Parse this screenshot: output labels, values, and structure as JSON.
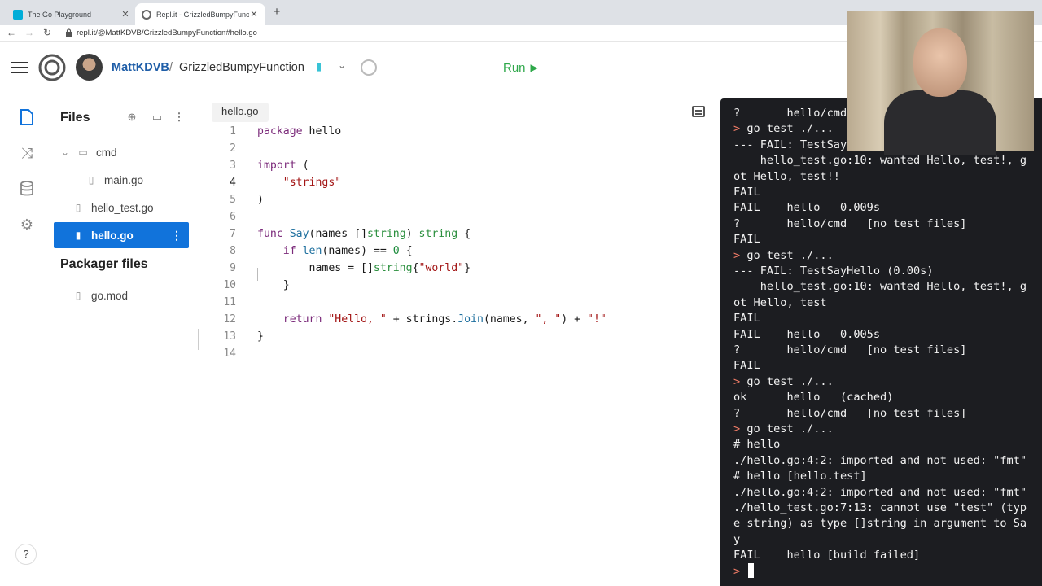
{
  "browser": {
    "tabs": [
      {
        "title": "The Go Playground",
        "active": false
      },
      {
        "title": "Repl.it - GrizzledBumpyFuncti",
        "active": true
      }
    ],
    "url": "repl.it/@MattKDVB/GrizzledBumpyFunction#hello.go"
  },
  "header": {
    "user": "MattKDVB",
    "separator": "/",
    "project": "GrizzledBumpyFunction",
    "run_label": "Run"
  },
  "files": {
    "title": "Files",
    "items": [
      {
        "name": "cmd",
        "type": "folder"
      },
      {
        "name": "main.go",
        "type": "file"
      },
      {
        "name": "hello_test.go",
        "type": "file"
      },
      {
        "name": "hello.go",
        "type": "file",
        "selected": true
      }
    ],
    "packager_title": "Packager files",
    "packager_items": [
      {
        "name": "go.mod"
      }
    ]
  },
  "editor": {
    "tab": "hello.go",
    "line_numbers": [
      "1",
      "2",
      "3",
      "4",
      "5",
      "6",
      "7",
      "8",
      "9",
      "10",
      "11",
      "12",
      "13",
      "14"
    ],
    "current_line": "4"
  },
  "terminal": {
    "lines": [
      "?       hello/cmd",
      "> go test ./...",
      "--- FAIL: TestSayHe",
      "    hello_test.go:10: wanted Hello, test!, g",
      "ot Hello, test!!",
      "FAIL",
      "FAIL    hello   0.009s",
      "?       hello/cmd   [no test files]",
      "FAIL",
      "> go test ./...",
      "--- FAIL: TestSayHello (0.00s)",
      "    hello_test.go:10: wanted Hello, test!, g",
      "ot Hello, test",
      "FAIL",
      "FAIL    hello   0.005s",
      "?       hello/cmd   [no test files]",
      "FAIL",
      "> go test ./...",
      "ok      hello   (cached)",
      "?       hello/cmd   [no test files]",
      "> go test ./...",
      "# hello",
      "./hello.go:4:2: imported and not used: \"fmt\"",
      "# hello [hello.test]",
      "./hello.go:4:2: imported and not used: \"fmt\"",
      "./hello_test.go:7:13: cannot use \"test\" (typ",
      "e string) as type []string in argument to Sa",
      "y",
      "FAIL    hello [build failed]",
      ">"
    ]
  },
  "help_label": "?",
  "colors": {
    "accent": "#1173db",
    "run_green": "#2ea84a",
    "terminal_bg": "#1c1d21",
    "prompt": "#ef7b66"
  }
}
